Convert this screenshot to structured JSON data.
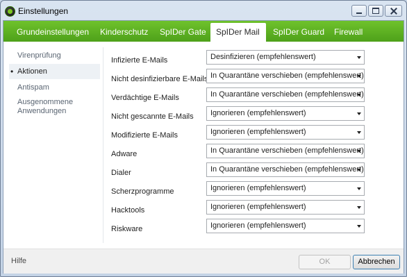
{
  "window": {
    "title": "Einstellungen",
    "accent_color": "#5cb224"
  },
  "tabs": [
    {
      "label": "Grundeinstellungen",
      "active": false
    },
    {
      "label": "Kinderschutz",
      "active": false
    },
    {
      "label": "SpIDer Gate",
      "active": false
    },
    {
      "label": "SpIDer Mail",
      "active": true
    },
    {
      "label": "SpIDer Guard",
      "active": false
    },
    {
      "label": "Firewall",
      "active": false
    }
  ],
  "sidebar": {
    "items": [
      {
        "label": "Virenprüfung",
        "active": false
      },
      {
        "label": "Aktionen",
        "active": true
      },
      {
        "label": "Antispam",
        "active": false
      },
      {
        "label_line1": "Ausgenommene",
        "label_line2": "Anwendungen",
        "active": false
      }
    ],
    "active_bullet": "•"
  },
  "actions": [
    {
      "label": "Infizierte E-Mails",
      "value": "Desinfizieren (empfehlenswert)"
    },
    {
      "label": "Nicht desinfizierbare E-Mails",
      "value": "In Quarantäne verschieben (empfehlenswert)"
    },
    {
      "label": "Verdächtige E-Mails",
      "value": "In Quarantäne verschieben (empfehlenswert)"
    },
    {
      "label": "Nicht gescannte E-Mails",
      "value": "Ignorieren (empfehlenswert)"
    },
    {
      "label": "Modifizierte E-Mails",
      "value": "Ignorieren (empfehlenswert)"
    },
    {
      "label": "Adware",
      "value": "In Quarantäne verschieben (empfehlenswert)"
    },
    {
      "label": "Dialer",
      "value": "In Quarantäne verschieben (empfehlenswert)"
    },
    {
      "label": "Scherzprogramme",
      "value": "Ignorieren (empfehlenswert)"
    },
    {
      "label": "Hacktools",
      "value": "Ignorieren (empfehlenswert)"
    },
    {
      "label": "Riskware",
      "value": "Ignorieren (empfehlenswert)"
    }
  ],
  "footer": {
    "help_label": "Hilfe",
    "ok_label": "OK",
    "ok_enabled": false,
    "cancel_label": "Abbrechen"
  }
}
